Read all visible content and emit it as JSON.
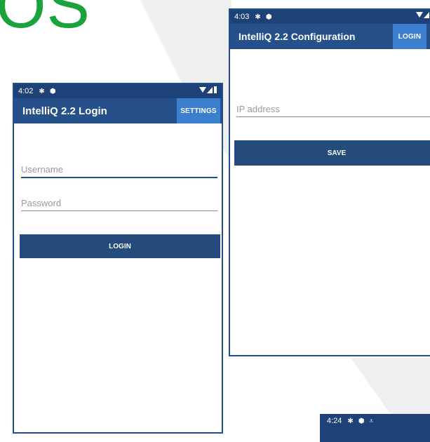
{
  "hero": {
    "text": "OS"
  },
  "colors": {
    "statusbar": "#1e4278",
    "appbar": "#26508a",
    "accent_button": "#3d7fcf",
    "primary_button": "#254b7d",
    "frame": "#1f4f8f",
    "hero_text": "#1aa33a"
  },
  "config_screen": {
    "status": {
      "time": "4:03"
    },
    "title": "IntelliQ 2.2 Configuration",
    "login_button": "LOGIN",
    "ip_placeholder": "IP address",
    "save_button": "SAVE"
  },
  "login_screen": {
    "status": {
      "time": "4:02"
    },
    "title": "IntelliQ 2.2 Login",
    "settings_button": "SETTINGS",
    "username_placeholder": "Username",
    "password_placeholder": "Password",
    "login_button": "LOGIN"
  },
  "third_screen": {
    "status": {
      "time": "4:24"
    }
  }
}
